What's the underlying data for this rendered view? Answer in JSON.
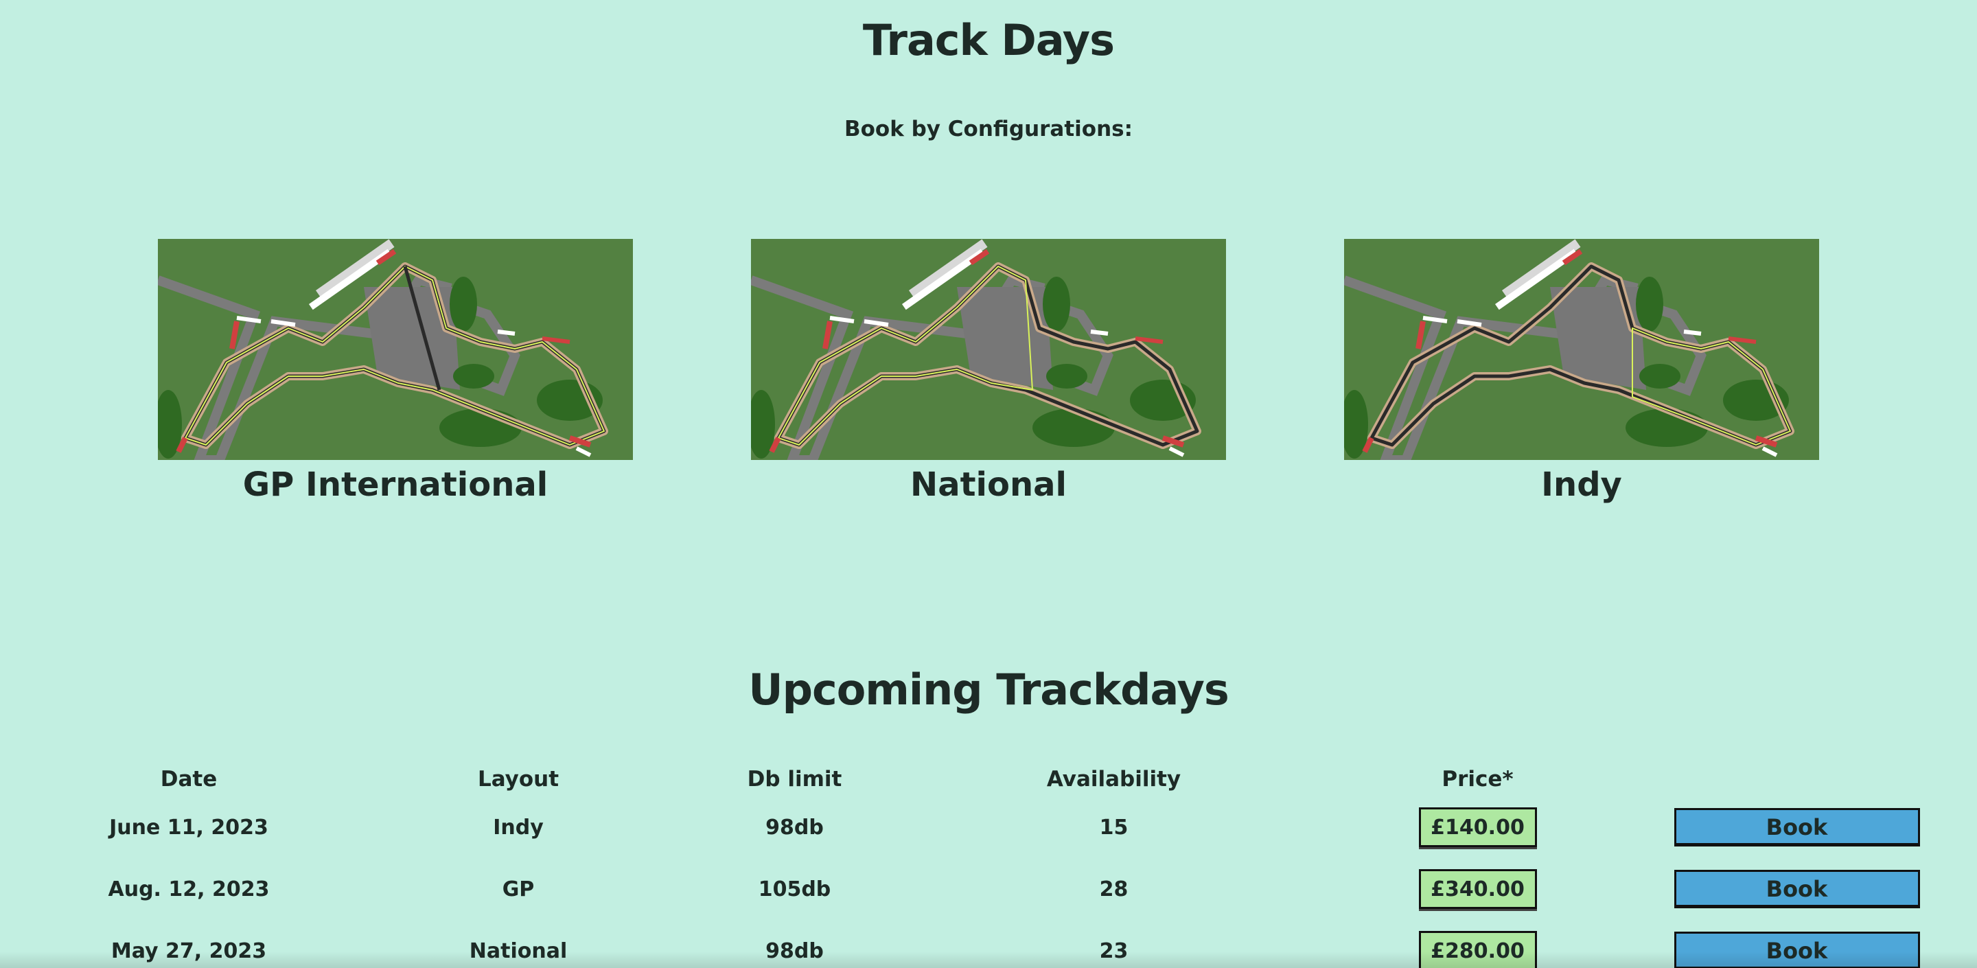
{
  "page": {
    "title": "Track Days",
    "subtitle": "Book by Configurations:"
  },
  "configurations": [
    {
      "name": "GP International",
      "icon": "circuit-map-gp-international",
      "highlight": "full"
    },
    {
      "name": "National",
      "icon": "circuit-map-national",
      "highlight": "national"
    },
    {
      "name": "Indy",
      "icon": "circuit-map-indy",
      "highlight": "indy"
    }
  ],
  "upcoming": {
    "heading": "Upcoming Trackdays",
    "columns": [
      "Date",
      "Layout",
      "Db limit",
      "Availability",
      "Price*",
      ""
    ],
    "rows": [
      {
        "date": "June 11, 2023",
        "layout": "Indy",
        "db_limit": "98db",
        "availability": "15",
        "price": "£140.00",
        "action": "Book"
      },
      {
        "date": "Aug. 12, 2023",
        "layout": "GP",
        "db_limit": "105db",
        "availability": "28",
        "price": "£340.00",
        "action": "Book"
      },
      {
        "date": "May 27, 2023",
        "layout": "National",
        "db_limit": "98db",
        "availability": "23",
        "price": "£280.00",
        "action": "Book"
      }
    ]
  },
  "colors": {
    "background": "#c2efe1",
    "map_grass": "#538141",
    "price_badge": "#aee8a1",
    "book_button": "#4ea7d9"
  }
}
